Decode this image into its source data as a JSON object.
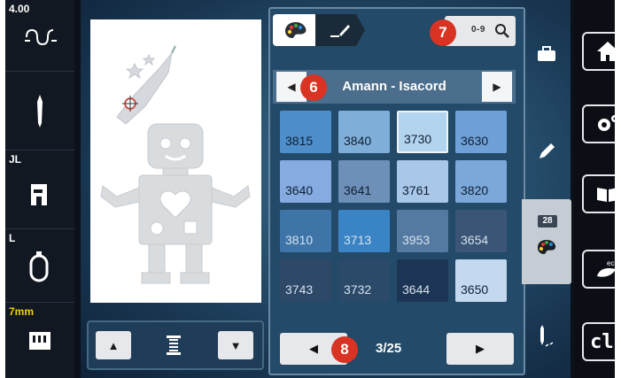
{
  "left_sidebar": {
    "cells": [
      {
        "label": "4.00",
        "icon": "presser-foot-icon"
      },
      {
        "label": "",
        "icon": "needle-icon"
      },
      {
        "label": "JL",
        "icon": "embroidery-foot-icon"
      },
      {
        "label": "L",
        "icon": "hoop-icon"
      },
      {
        "label": "7mm",
        "icon": "stitch-plate-icon"
      }
    ]
  },
  "preview": {
    "design": "robot-embroidery"
  },
  "bottom_controls": {
    "up_icon": "▲",
    "down_icon": "▼",
    "center_icon": "spool-icon"
  },
  "top_tabs": {
    "tab1_icon": "color-palette-icon",
    "tab2_icon": "edit-arrow-icon",
    "search_label": "0-9"
  },
  "brand": {
    "name": "Amann - Isacord",
    "left_arrow": "◀",
    "right_arrow": "▶"
  },
  "badges": {
    "b6": "6",
    "b7": "7",
    "b8": "8"
  },
  "swatches": [
    {
      "code": "3815",
      "color": "#4d8ecb"
    },
    {
      "code": "3840",
      "color": "#7faed8"
    },
    {
      "code": "3730",
      "color": "#b3d4ee",
      "selected": true
    },
    {
      "code": "3630",
      "color": "#6fa1d8"
    },
    {
      "code": "3640",
      "color": "#86abe0"
    },
    {
      "code": "3641",
      "color": "#6e8fb8"
    },
    {
      "code": "3761",
      "color": "#a9c7e8"
    },
    {
      "code": "3820",
      "color": "#7ba8d9"
    },
    {
      "code": "3810",
      "color": "#3e74a8",
      "dark": true
    },
    {
      "code": "3713",
      "color": "#3a84c6",
      "dark": true
    },
    {
      "code": "3953",
      "color": "#557aa2",
      "dark": true
    },
    {
      "code": "3654",
      "color": "#3a5575",
      "dark": true
    },
    {
      "code": "3743",
      "color": "#2e4868",
      "dark": true
    },
    {
      "code": "3732",
      "color": "#2b4a69",
      "dark": true
    },
    {
      "code": "3644",
      "color": "#1c3554",
      "dark": true
    },
    {
      "code": "3650",
      "color": "#c2d9ef"
    }
  ],
  "pager": {
    "text": "3/25",
    "prev": "◀",
    "next": "▶"
  },
  "right_strip": {
    "badge": "28"
  },
  "right_sidebar": {
    "clr_label": "clr"
  }
}
